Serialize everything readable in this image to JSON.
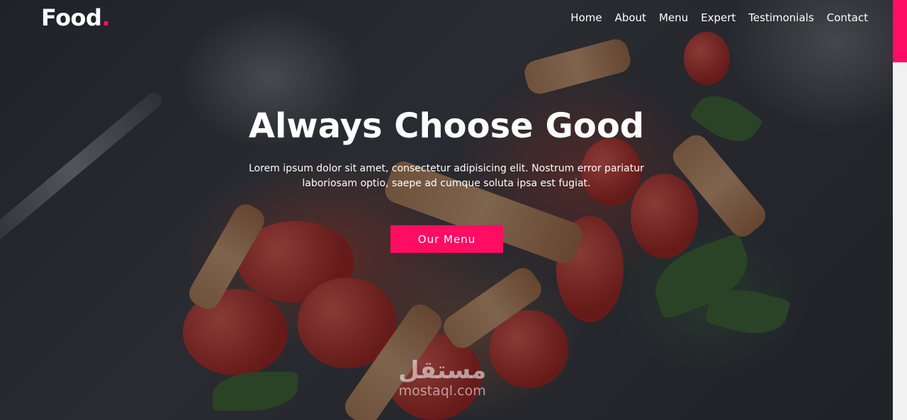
{
  "brand": {
    "name": "Food",
    "dot": ".",
    "accent_color": "#ff0d63"
  },
  "nav": {
    "items": [
      {
        "label": "Home"
      },
      {
        "label": "About"
      },
      {
        "label": "Menu"
      },
      {
        "label": "Expert"
      },
      {
        "label": "Testimonials"
      },
      {
        "label": "Contact"
      }
    ]
  },
  "hero": {
    "title": "Always Choose Good",
    "subtitle": "Lorem ipsum dolor sit amet, consectetur adipisicing elit. Nostrum error pariatur laboriosam optio, saepe ad cumque soluta ipsa est fugiat.",
    "cta_label": "Our Menu",
    "background_image": "pasta-salad-with-tomatoes"
  },
  "watermark": {
    "arabic": "مستقل",
    "latin": "mostaql.com"
  }
}
